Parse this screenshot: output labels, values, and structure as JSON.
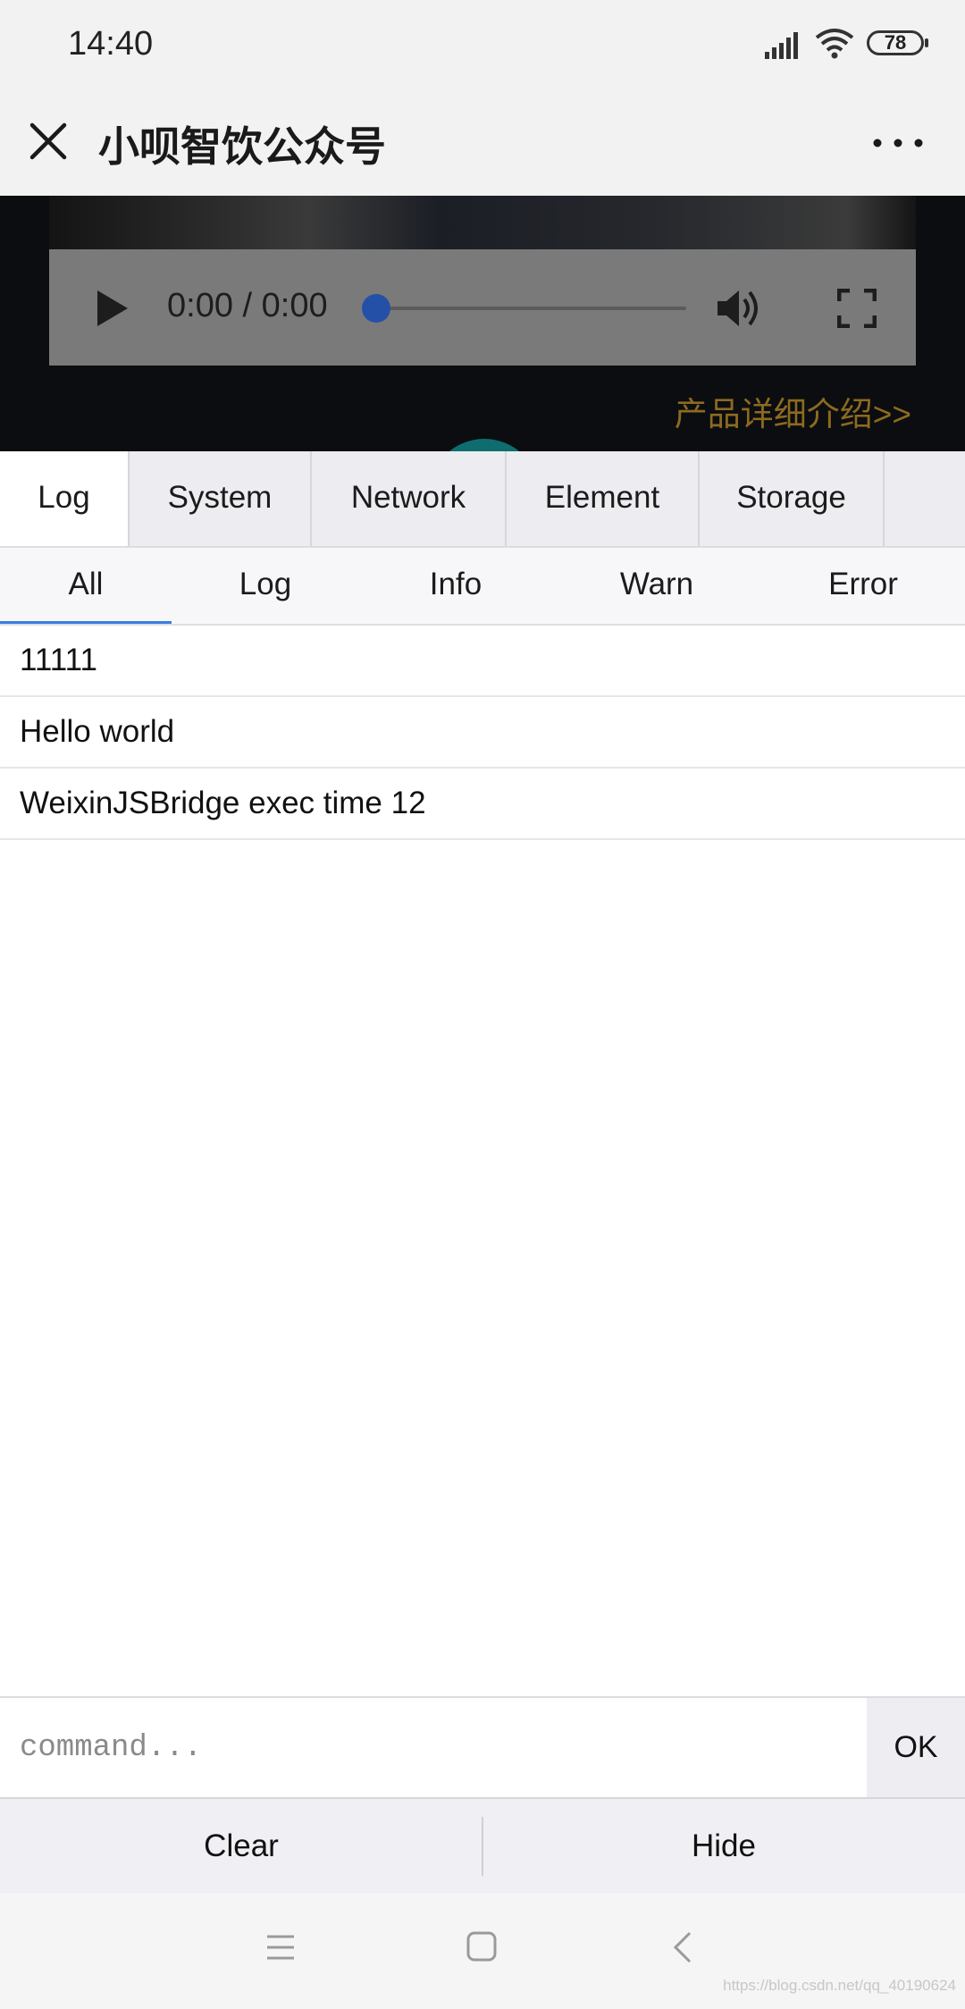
{
  "status_bar": {
    "time": "14:40",
    "battery": "78"
  },
  "title_bar": {
    "title": "小呗智饮公众号"
  },
  "banner": {
    "video_time": "0:00 / 0:00",
    "product_link": "产品详细介绍>>",
    "link_color": "#8c6a20"
  },
  "main_tabs": [
    {
      "label": "Log",
      "active": true
    },
    {
      "label": "System"
    },
    {
      "label": "Network"
    },
    {
      "label": "Element"
    },
    {
      "label": "Storage"
    }
  ],
  "sub_tabs": [
    {
      "label": "All",
      "active": true
    },
    {
      "label": "Log"
    },
    {
      "label": "Info"
    },
    {
      "label": "Warn"
    },
    {
      "label": "Error"
    }
  ],
  "logs": [
    "11111",
    "Hello world",
    "WeixinJSBridge exec time 12"
  ],
  "command": {
    "placeholder": "command...",
    "ok_label": "OK"
  },
  "bottom": {
    "clear_label": "Clear",
    "hide_label": "Hide"
  },
  "watermark": "https://blog.csdn.net/qq_40190624",
  "colors": {
    "accent": "#3a7de0",
    "progress_thumb": "#2450a8"
  }
}
